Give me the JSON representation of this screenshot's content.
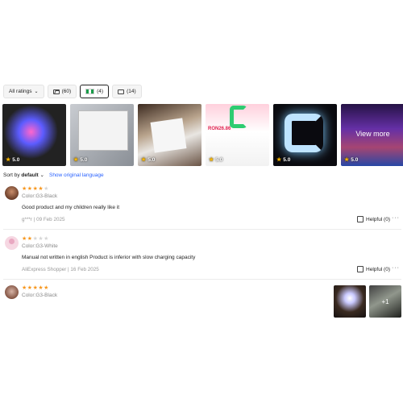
{
  "filters": {
    "all_ratings": "All ratings",
    "photos_count": "(60)",
    "country_count": "(4)",
    "comments_count": "(14)"
  },
  "gallery": {
    "items": [
      {
        "rating": "5.0"
      },
      {
        "rating": "5.0"
      },
      {
        "rating": "5.0"
      },
      {
        "rating": "5.0",
        "price_text": "RON26.86"
      },
      {
        "rating": "5.0"
      },
      {
        "rating": "5.0",
        "overlay": "View more"
      }
    ]
  },
  "sort": {
    "prefix": "Sort by",
    "value": "default",
    "translate_link": "Show original language"
  },
  "reviews": [
    {
      "stars": 4,
      "color": "Color:G3-Black",
      "text": "Good product and my children really like it",
      "meta": "g***r | 09 Feb 2025",
      "helpful": "Helpful (0)"
    },
    {
      "stars": 2,
      "color": "Color:G3-White",
      "text": "Manual not written in english Product is inferior with slow charging capacity",
      "meta": "AliExpress Shopper | 16 Feb 2025",
      "helpful": "Helpful (0)"
    },
    {
      "stars": 5,
      "color": "Color:G3-Black",
      "extra_images": "+1"
    }
  ],
  "colors": {
    "link": "#2962ff",
    "star_on": "#f7971e",
    "star_off": "#d6d6d6",
    "flag_green": "#1a9c4a"
  }
}
